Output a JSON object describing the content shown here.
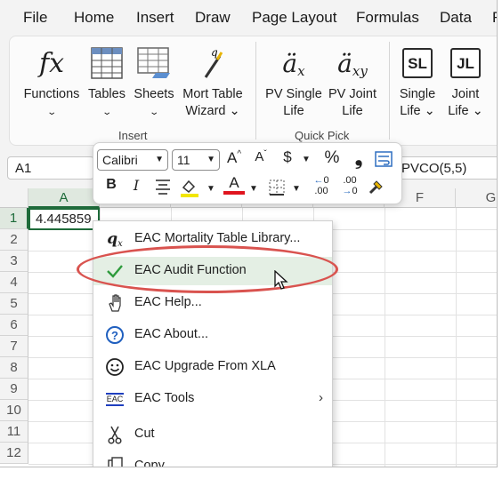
{
  "menu": [
    "File",
    "Home",
    "Insert",
    "Draw",
    "Page Layout",
    "Formulas",
    "Data",
    "R"
  ],
  "ribbon": {
    "insert_group": {
      "label": "Insert",
      "buttons": [
        {
          "line1": "Functions",
          "line2": "⌄",
          "icon": "function-fx-icon",
          "icon_text": "fx"
        },
        {
          "line1": "Tables",
          "line2": "⌄",
          "icon": "table-icon"
        },
        {
          "line1": "Sheets",
          "line2": "⌄",
          "icon": "sheets-icon"
        },
        {
          "line1": "Mort Table",
          "line2": "Wizard ⌄",
          "icon": "wizard-wand-icon",
          "icon_text": "q"
        }
      ]
    },
    "quickpick_group": {
      "label": "Quick Pick",
      "buttons": [
        {
          "line1": "PV Single",
          "line2": "Life",
          "icon_base": "ä",
          "icon_sub": "x"
        },
        {
          "line1": "PV Joint",
          "line2": "Life",
          "icon_base": "ä",
          "icon_sub": "xy"
        }
      ]
    },
    "life_group": {
      "buttons": [
        {
          "line1": "Single",
          "line2": "Life ⌄",
          "icon_text": "SL"
        },
        {
          "line1": "Joint",
          "line2": "Life ⌄",
          "icon_text": "JL"
        }
      ]
    }
  },
  "formula_bar": {
    "name_box": "A1",
    "formula_text": "PVCO(5,5)"
  },
  "grid": {
    "columns": [
      "A",
      "",
      "",
      "",
      "",
      "F",
      "G"
    ],
    "rows": [
      "1",
      "2",
      "3",
      "4",
      "5",
      "6",
      "7",
      "8",
      "9",
      "10",
      "11",
      "12"
    ],
    "a1_value": "4.445859"
  },
  "mini_toolbar": {
    "font": "Calibri",
    "size": "11",
    "grow_font": "A",
    "shrink_font": "A",
    "currency": "$",
    "percent": "%",
    "comma": "❟",
    "bold": "B",
    "italic": "I",
    "font_color_letter": "A",
    "increase_decimal": ".00",
    "decrease_decimal": ".00",
    "accent_colors": {
      "fill": "#f2e600",
      "font": "#e0141e",
      "wrap": "#2f6fc0"
    }
  },
  "context_menu": {
    "items": [
      {
        "label": "EAC Mortality Table Library...",
        "icon": "q-sub-x-icon"
      },
      {
        "label": "EAC Audit Function",
        "icon": "checkmark-icon",
        "highlight": true
      },
      {
        "label": "EAC Help...",
        "icon": "hand-pointer-icon"
      },
      {
        "label": "EAC About...",
        "icon": "question-circle-icon"
      },
      {
        "label": "EAC Upgrade From XLA",
        "icon": "smiley-icon"
      },
      {
        "label": "EAC Tools",
        "icon": "eac-tools-icon",
        "icon_text": "EAC",
        "submenu": "›"
      },
      {
        "label": "Cut",
        "icon": "scissors-icon"
      },
      {
        "label": "Copy",
        "icon": "copy-icon"
      }
    ]
  },
  "colors": {
    "accent_green": "#1e6b3a",
    "highlight_ellipse": "#d9534f"
  }
}
